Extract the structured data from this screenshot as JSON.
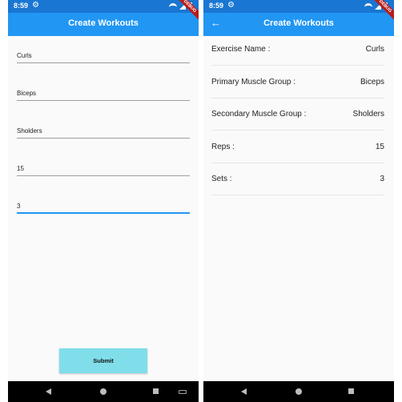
{
  "status_bar": {
    "time": "8:59"
  },
  "debug_banner": "DEBUG",
  "form_screen": {
    "title": "Create Workouts",
    "fields": [
      {
        "value": "Curls"
      },
      {
        "value": "Biceps"
      },
      {
        "value": "Sholders"
      },
      {
        "value": "15"
      },
      {
        "value": "3"
      }
    ],
    "submit_label": "Submit"
  },
  "details_screen": {
    "title": "Create Workouts",
    "rows": [
      {
        "label": "Exercise Name :",
        "value": "Curls"
      },
      {
        "label": "Primary Muscle Group :",
        "value": "Biceps"
      },
      {
        "label": "Secondary Muscle Group :",
        "value": "Sholders"
      },
      {
        "label": "Reps :",
        "value": "15"
      },
      {
        "label": "Sets :",
        "value": "3"
      }
    ]
  },
  "icons": {
    "settings": "gear-icon",
    "wifi": "wifi-icon",
    "signal": "signal-icon",
    "battery": "battery-icon",
    "back": "back-arrow-icon"
  },
  "colors": {
    "status_bar": "#1976d2",
    "app_bar": "#2196f3",
    "submit_button": "#80deea",
    "focus_underline": "#2196f3",
    "debug_banner": "#b71c1c"
  }
}
